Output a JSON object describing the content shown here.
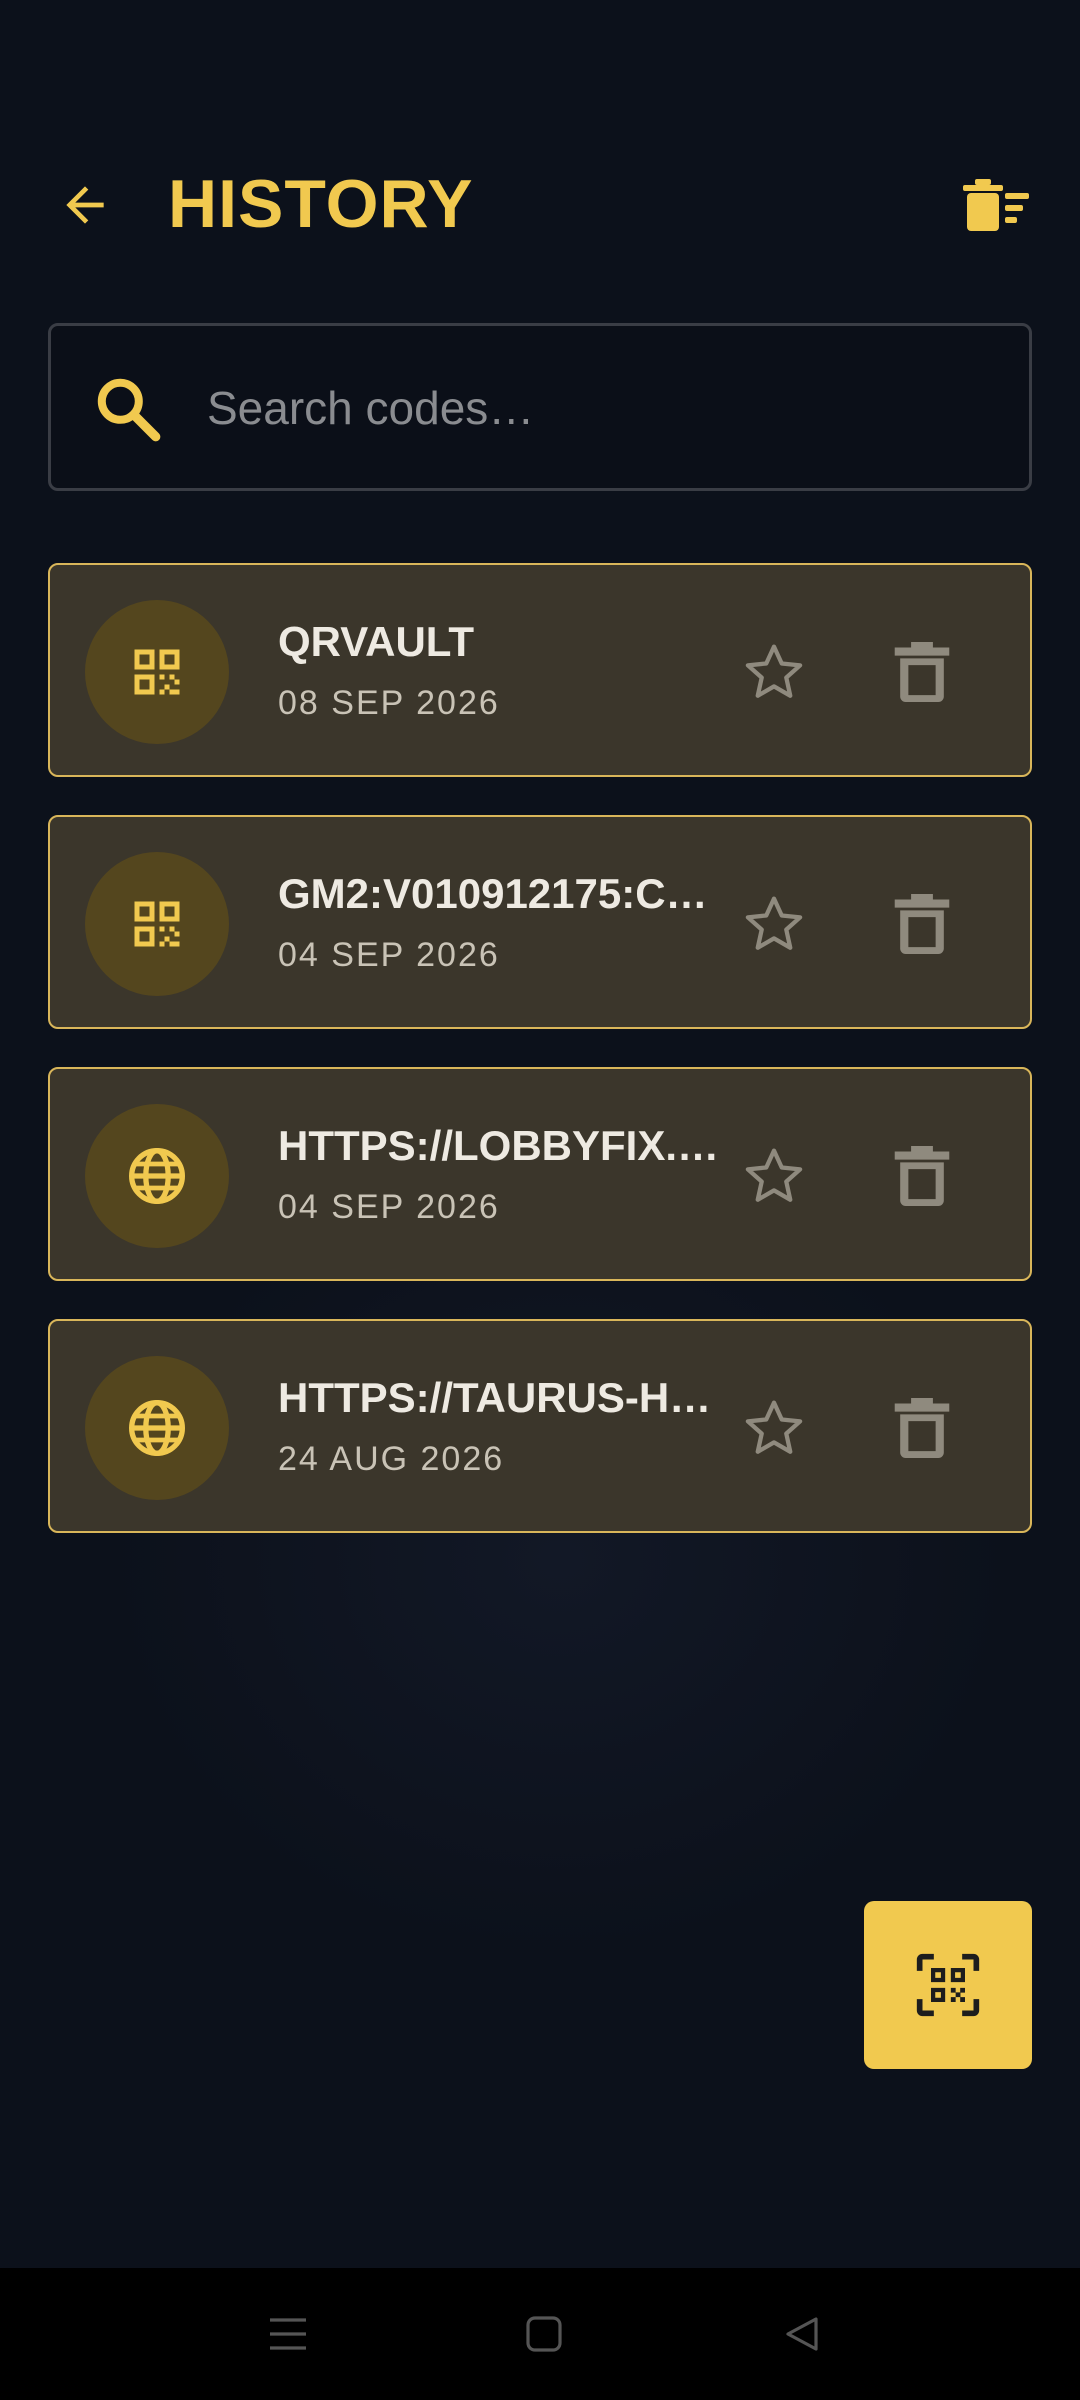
{
  "header": {
    "title": "HISTORY",
    "back_icon": "arrow-left-icon",
    "clear_icon": "clear-all-trash-icon"
  },
  "search": {
    "placeholder": "Search codes…",
    "value": "",
    "icon": "search-icon"
  },
  "history": [
    {
      "title": "QRVAULT",
      "date": "08 SEP 2026",
      "type_icon": "qr-code-icon",
      "favorite": false
    },
    {
      "title": "GM2:V010912175:C…",
      "date": "04 SEP 2026",
      "type_icon": "qr-code-icon",
      "favorite": false
    },
    {
      "title": "HTTPS://LOBBYFIX.…",
      "date": "04 SEP 2026",
      "type_icon": "globe-icon",
      "favorite": false
    },
    {
      "title": "HTTPS://TAURUS-H…",
      "date": "24 AUG 2026",
      "type_icon": "globe-icon",
      "favorite": false
    }
  ],
  "fab": {
    "icon": "qr-scan-icon"
  },
  "navbar": {
    "icons": [
      "menu-icon",
      "home-icon",
      "back-icon"
    ]
  },
  "colors": {
    "accent": "#f1c94f",
    "background": "#0c111b",
    "card_bg": "#3b362b",
    "card_border": "#d9b65a",
    "badge_bg": "#54461e",
    "muted_icon": "#8f8a7e"
  }
}
